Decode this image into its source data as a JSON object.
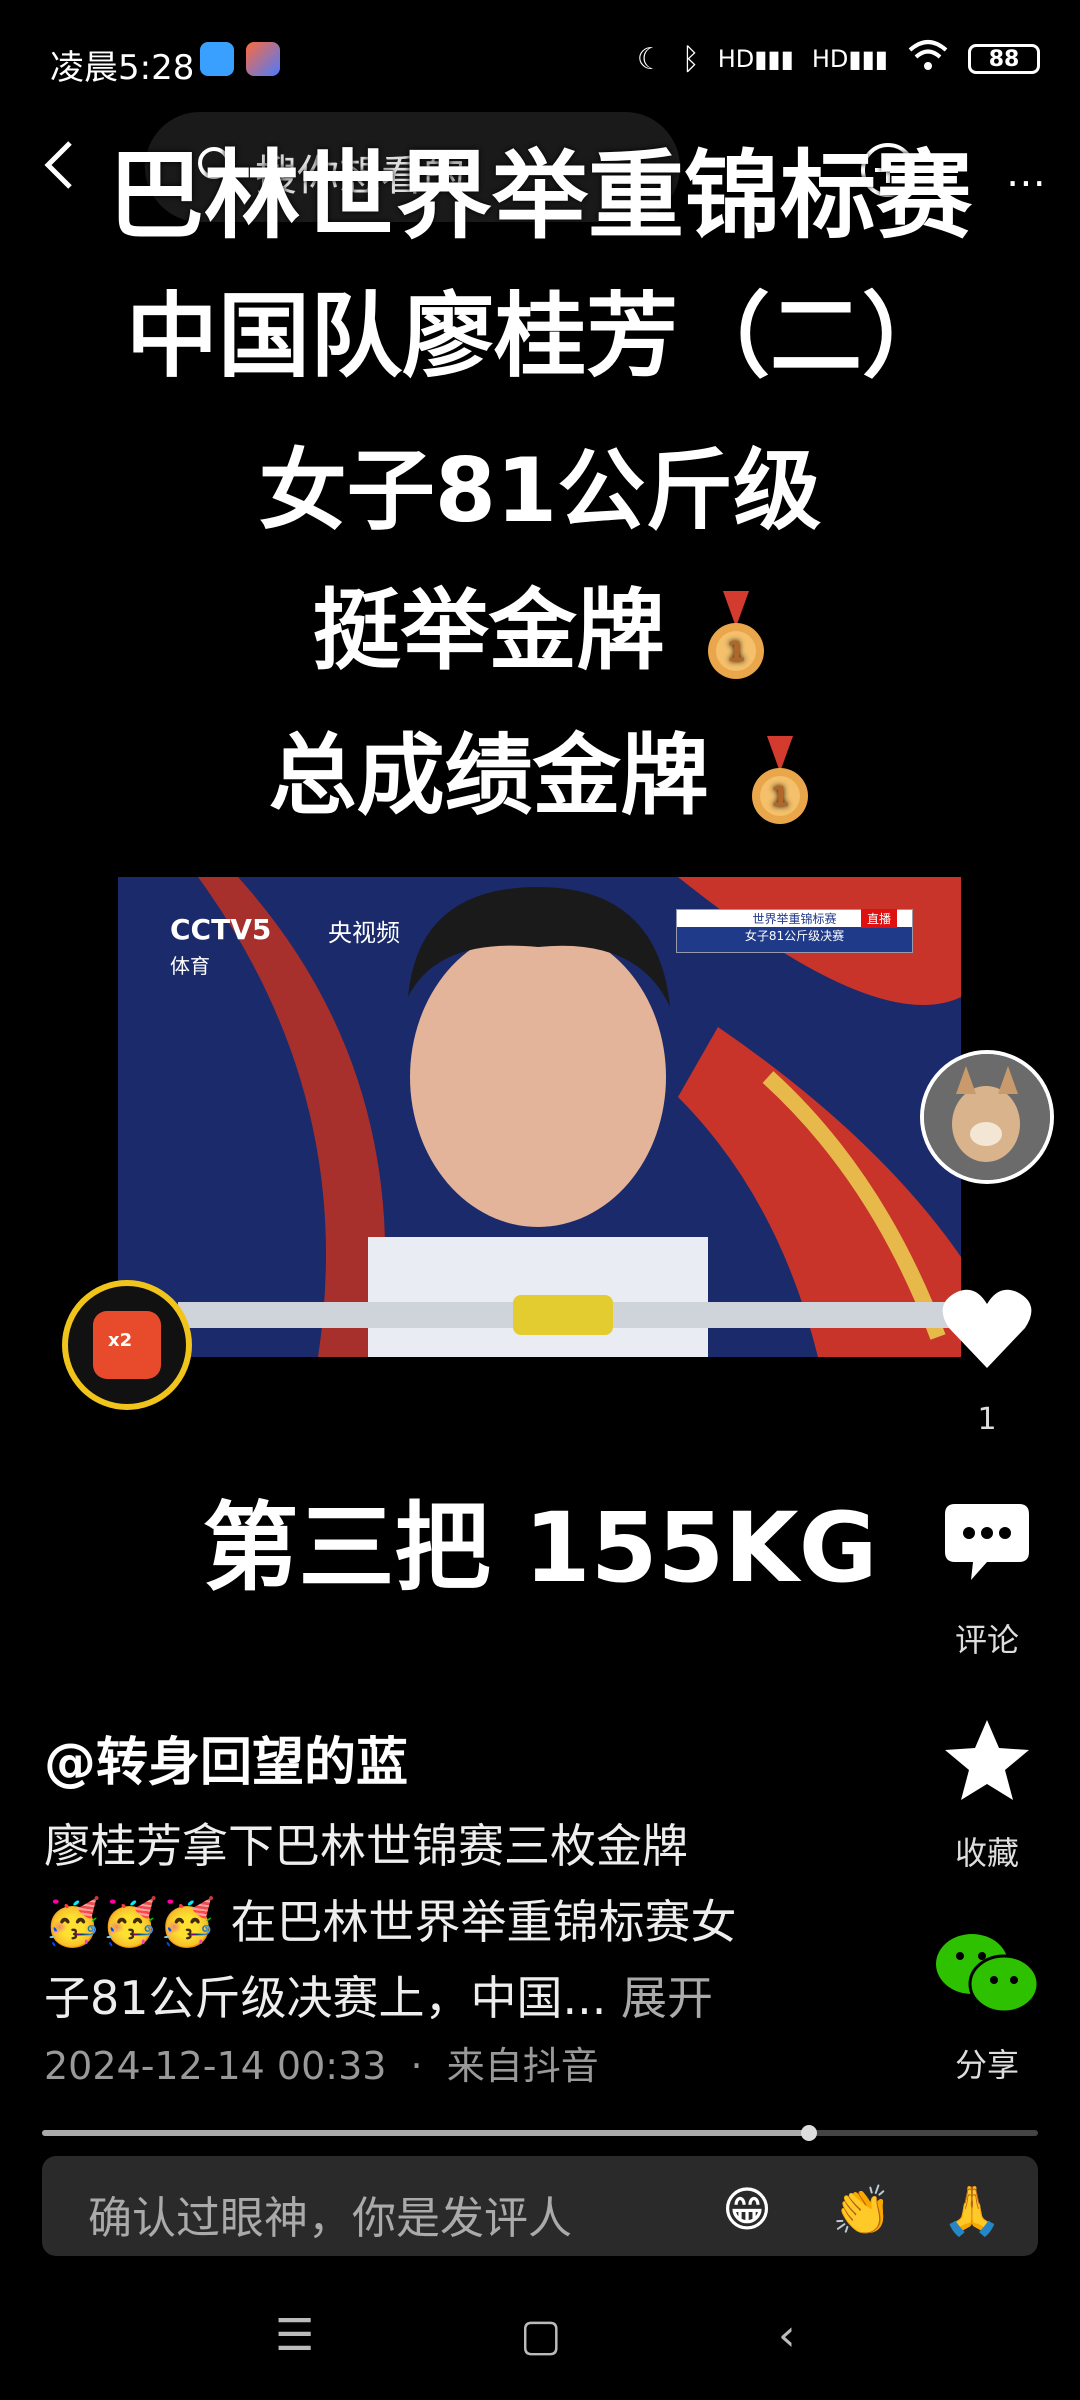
{
  "status_bar": {
    "time": "凌晨5:28",
    "battery": "88",
    "network_label": "HD"
  },
  "top_bar": {
    "search_placeholder": "搜你想看的"
  },
  "headline": {
    "line1": "巴林世界举重锦标赛",
    "line2": "中国队廖桂芳（二）",
    "line3": "女子81公斤级",
    "line4": "挺举金牌",
    "line5": "总成绩金牌"
  },
  "video": {
    "channel": "CCTV5",
    "channel_sub": "体育",
    "platform": "央视频",
    "scoreboard_title": "世界举重锦标赛",
    "scoreboard_sub": "女子81公斤级决赛",
    "live": "直播"
  },
  "overlay_text": "第三把 155KG",
  "red_packet": {
    "label": "x2"
  },
  "rail": {
    "like_count": "1",
    "comment_label": "评论",
    "favorite_label": "收藏",
    "share_label": "分享"
  },
  "caption": {
    "author": "@转身回望的蓝",
    "line1": "廖桂芳拿下巴林世锦赛三枚金牌",
    "line2_emoji": "🥳🥳🥳",
    "line2_text": " 在巴林世界举重锦标赛女",
    "line3": "子81公斤级决赛上，中国...",
    "expand": "展开",
    "date": "2024-12-14 00:33",
    "separator": "·",
    "source": "来自抖音"
  },
  "progress": {
    "played_fraction": 0.77
  },
  "comment_input": {
    "placeholder": "确认过眼神，你是发评人",
    "emoji1": "😁",
    "emoji2": "👏",
    "emoji3": "🙏"
  },
  "colors": {
    "background": "#000000",
    "gold_ring": "#f0c41a",
    "wechat_green": "#2dc100",
    "red_packet": "#e84b2c"
  }
}
